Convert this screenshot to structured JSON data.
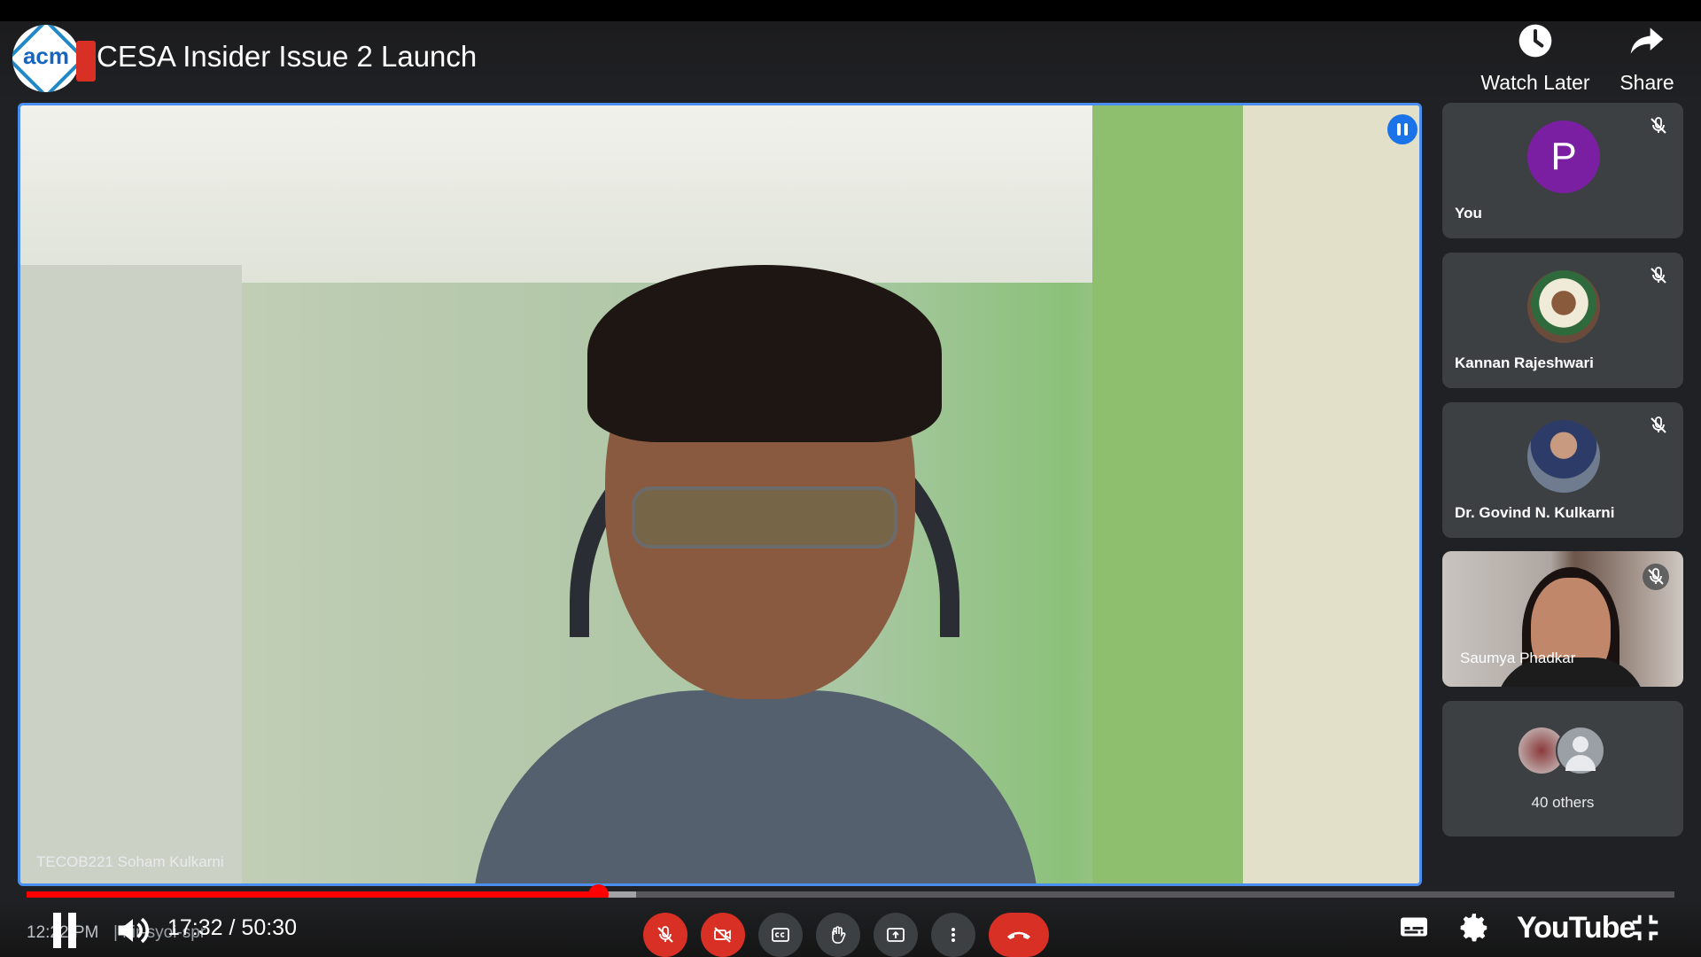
{
  "header": {
    "title": "CESA Insider Issue 2 Launch",
    "logo_text": "acm",
    "actions": [
      {
        "label": "Watch Later",
        "icon": "clock-icon"
      },
      {
        "label": "Share",
        "icon": "share-arrow-icon"
      }
    ]
  },
  "main_video": {
    "speaker_name": "TECOB221 Soham Kulkarni",
    "speaking_indicator": true
  },
  "participants": [
    {
      "name": "You",
      "avatar_letter": "P",
      "avatar_color": "#7b1fa2",
      "muted": true
    },
    {
      "name": "Kannan Rajeshwari",
      "muted": true
    },
    {
      "name": "Dr. Govind N. Kulkarni",
      "muted": true
    },
    {
      "name": "Saumya Phadkar",
      "muted": true,
      "video_on": true
    }
  ],
  "others": {
    "label": "40 others"
  },
  "player": {
    "current_time": "17:32",
    "separator": "/",
    "duration": "50:30",
    "played_fraction": 0.347,
    "loaded_fraction": 0.37,
    "progress_color": "#ff0000",
    "ghost_clock": "12:22 PM",
    "ghost_code": "| hir-syoi-spr"
  },
  "meet_toolbar": {
    "buttons": [
      "mic-off-icon",
      "camera-off-icon",
      "captions-icon",
      "raise-hand-icon",
      "present-icon",
      "more-vert-icon",
      "end-call-icon"
    ],
    "danger_color": "#d93025"
  },
  "youtube": {
    "logo_text": "YouTube"
  }
}
